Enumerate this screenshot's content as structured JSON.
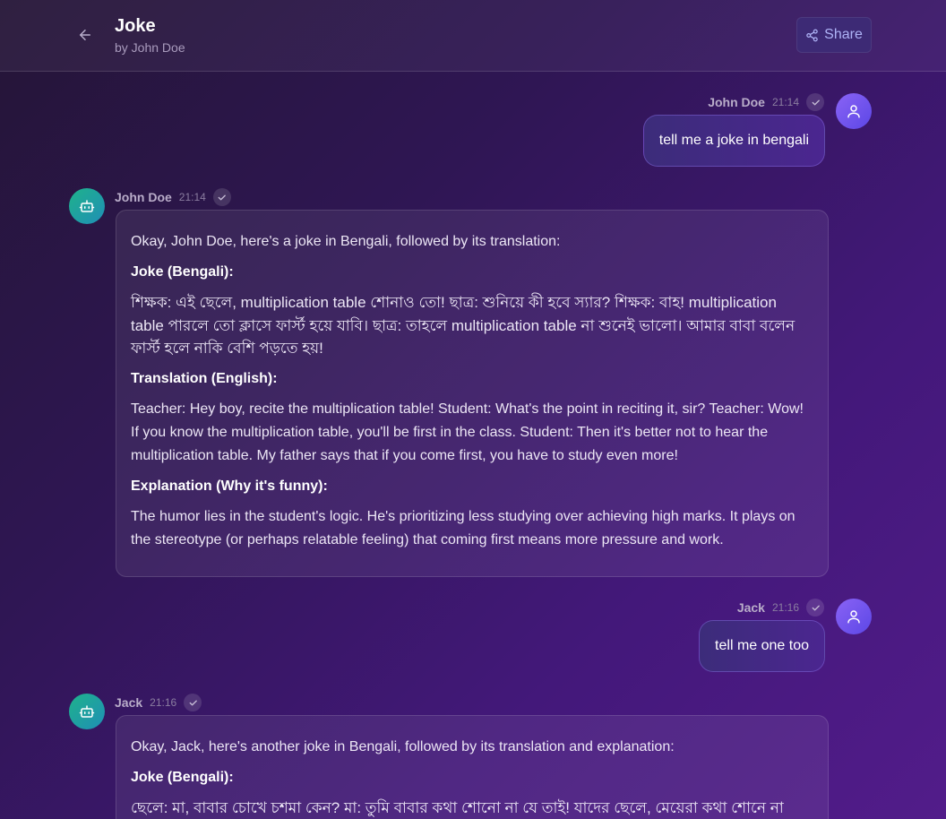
{
  "header": {
    "title": "Joke",
    "subtitle": "by John Doe",
    "share_label": "Share"
  },
  "messages": [
    {
      "role": "user",
      "author": "John Doe",
      "time": "21:14",
      "text": "tell me a joke in bengali"
    },
    {
      "role": "assistant",
      "author": "John Doe",
      "time": "21:14",
      "intro": "Okay, John Doe, here's a joke in Bengali, followed by its translation:",
      "joke_heading": "Joke (Bengali):",
      "joke_text": "শিক্ষক: এই ছেলে, multiplication table শোনাও তো! ছাত্র: শুনিয়ে কী হবে স্যার? শিক্ষক: বাহ! multiplication table পারলে তো ক্লাসে ফার্স্ট হয়ে যাবি। ছাত্র: তাহলে multiplication table না শুনেই ভালো। আমার বাবা বলেন ফার্স্ট হলে নাকি বেশি পড়তে হয়!",
      "translation_heading": "Translation (English):",
      "translation_text": "Teacher: Hey boy, recite the multiplication table! Student: What's the point in reciting it, sir? Teacher: Wow! If you know the multiplication table, you'll be first in the class. Student: Then it's better not to hear the multiplication table. My father says that if you come first, you have to study even more!",
      "explanation_heading": "Explanation (Why it's funny):",
      "explanation_text": "The humor lies in the student's logic. He's prioritizing less studying over achieving high marks. It plays on the stereotype (or perhaps relatable feeling) that coming first means more pressure and work."
    },
    {
      "role": "user",
      "author": "Jack",
      "time": "21:16",
      "text": "tell me one too"
    },
    {
      "role": "assistant",
      "author": "Jack",
      "time": "21:16",
      "intro": "Okay, Jack, here's another joke in Bengali, followed by its translation and explanation:",
      "joke_heading": "Joke (Bengali):",
      "joke_text": "ছেলে: মা, বাবার চোখে চশমা কেন? মা: তুমি বাবার কথা শোনো না যে তাই! যাদের ছেলে, মেয়েরা কথা শোনে না"
    }
  ],
  "icons": {
    "back": "arrow-left-icon",
    "share": "share-icon",
    "check": "check-icon",
    "user_avatar": "user-icon",
    "bot_avatar": "bot-icon"
  },
  "colors": {
    "accent": "#3d2a75",
    "share_text": "#aeb3f6",
    "user_avatar": "#7a56f0",
    "bot_avatar": "#1fa39a"
  }
}
